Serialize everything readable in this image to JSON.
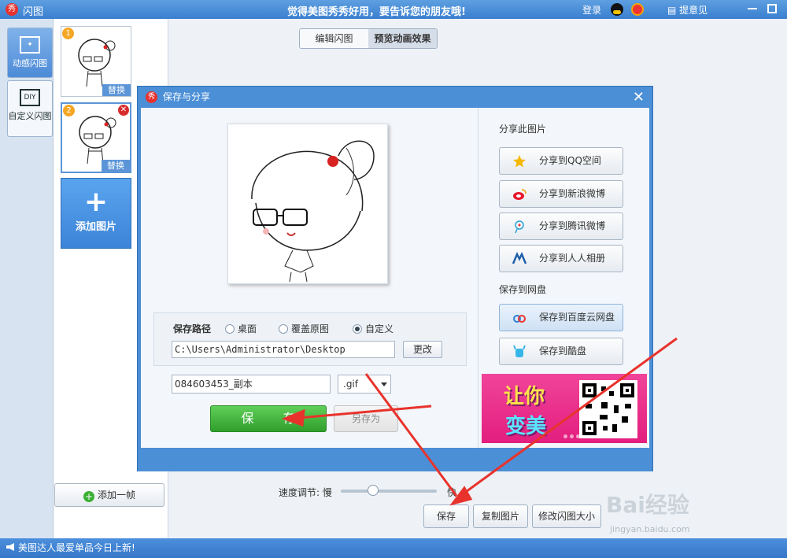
{
  "titlebar": {
    "app_title": "闪图",
    "logo_char": "秀",
    "slogan": "觉得美图秀秀好用，要告诉您的朋友哦!",
    "login": "登录",
    "feedback": "提意见"
  },
  "left_tabs": [
    {
      "label": "动感闪图",
      "icon": "sparkle-frame-icon",
      "active": true
    },
    {
      "label": "自定义闪图",
      "icon": "diy-icon",
      "icon_text": "DIY",
      "active": false
    }
  ],
  "thumbnails": [
    {
      "number": "1",
      "replace_label": "替换"
    },
    {
      "number": "2",
      "replace_label": "替换"
    }
  ],
  "add_picture_label": "添加图片",
  "add_frame_label": "添加一帧",
  "view_switch": {
    "edit": "编辑闪图",
    "preview": "预览动画效果"
  },
  "speed": {
    "label": "速度调节:",
    "slow": "慢",
    "fast": "快",
    "value": 0.3
  },
  "bottom_buttons": {
    "save": "保存",
    "copy": "复制图片",
    "resize": "修改闪图大小"
  },
  "status_text": "美图达人最爱单品今日上新!",
  "dialog": {
    "title": "保存与分享",
    "logo_char": "秀",
    "save_path_label": "保存路径",
    "path_options": [
      {
        "label": "桌面",
        "selected": false
      },
      {
        "label": "覆盖原图",
        "selected": false
      },
      {
        "label": "自定义",
        "selected": true
      }
    ],
    "path_value": "C:\\Users\\Administrator\\Desktop",
    "change_button": "更改",
    "filename": "084603453_副本",
    "extension": ".gif",
    "save_button": "保 存",
    "save_as_button": "另存为",
    "share_section": "分享此图片",
    "share_buttons": [
      {
        "label": "分享到QQ空间",
        "icon": "qzone-star-icon"
      },
      {
        "label": "分享到新浪微博",
        "icon": "sina-weibo-icon"
      },
      {
        "label": "分享到腾讯微博",
        "icon": "tencent-weibo-icon"
      },
      {
        "label": "分享到人人相册",
        "icon": "renren-icon"
      }
    ],
    "cloud_section": "保存到网盘",
    "cloud_buttons": [
      {
        "label": "保存到百度云网盘",
        "icon": "baidu-cloud-icon"
      },
      {
        "label": "保存到酷盘",
        "icon": "kupan-icon"
      }
    ],
    "ad": {
      "line1": "让你",
      "line2": "变美"
    }
  },
  "watermark": {
    "brand": "Bai经验",
    "url": "jingyan.baidu.com"
  },
  "colors": {
    "accent": "#4b8fd6",
    "save_green": "#3cb035",
    "arrow_red": "#e8332c"
  }
}
